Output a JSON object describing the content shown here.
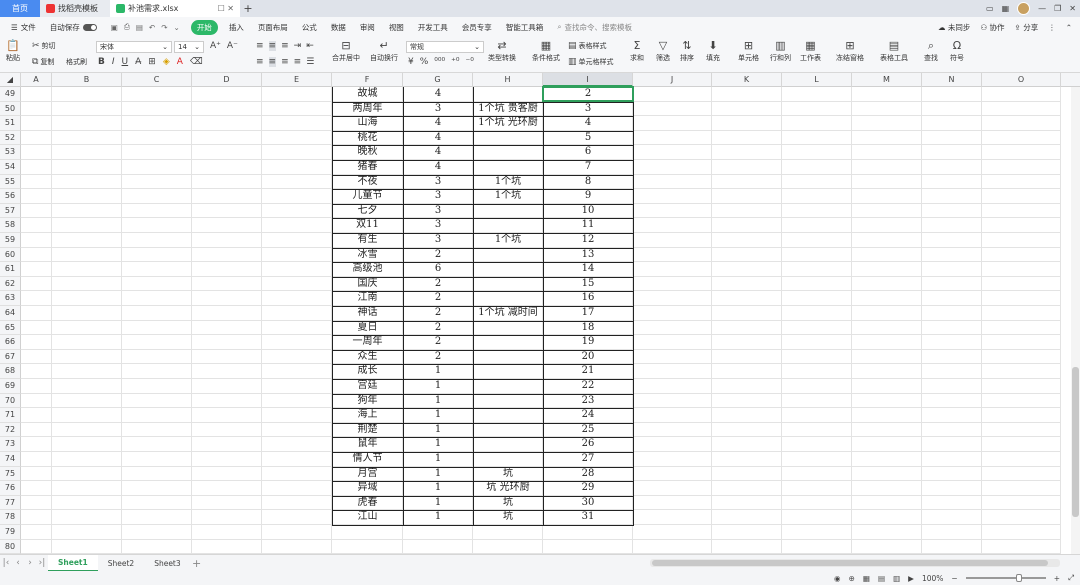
{
  "titlebar": {
    "tabs": [
      {
        "label": "首页"
      },
      {
        "label": "找稻壳模板"
      },
      {
        "label": "补池需求.xlsx"
      }
    ]
  },
  "menubar": {
    "file": "文件",
    "autosave": "自动保存",
    "items": [
      "开始",
      "插入",
      "页面布局",
      "公式",
      "数据",
      "审阅",
      "视图",
      "开发工具",
      "会员专享",
      "智能工具箱"
    ],
    "search_placeholder": "查找命令、搜索模板",
    "right": [
      "未同步",
      "协作",
      "分享"
    ]
  },
  "ribbon": {
    "paste": "粘贴",
    "cut": "剪切",
    "copy": "复制",
    "format_painter": "格式刷",
    "font_name": "宋体",
    "font_size": "14",
    "merge": "合并居中",
    "wrap": "自动换行",
    "number_format": "常规",
    "type_convert": "类型转换",
    "cond_format": "条件格式",
    "table_style": "表格样式",
    "cell_style": "单元格样式",
    "sum": "求和",
    "filter": "筛选",
    "sort": "排序",
    "fill": "填充",
    "cells": "单元格",
    "rowcol": "行和列",
    "worksheet": "工作表",
    "freeze": "冻结窗格",
    "table_tools": "表格工具",
    "find": "查找",
    "symbol": "符号"
  },
  "grid": {
    "columns": [
      "A",
      "B",
      "C",
      "D",
      "E",
      "F",
      "G",
      "H",
      "I",
      "J",
      "K",
      "L",
      "M",
      "N",
      "O"
    ],
    "rows": [
      {
        "n": "49",
        "f": "故城",
        "g": "4",
        "h": "",
        "i": "2"
      },
      {
        "n": "50",
        "f": "两周年",
        "g": "3",
        "h": "1个坑  贵客厨",
        "i": "3"
      },
      {
        "n": "51",
        "f": "山海",
        "g": "4",
        "h": "1个坑  光环厨",
        "i": "4"
      },
      {
        "n": "52",
        "f": "桃花",
        "g": "4",
        "h": "",
        "i": "5"
      },
      {
        "n": "53",
        "f": "晚秋",
        "g": "4",
        "h": "",
        "i": "6"
      },
      {
        "n": "54",
        "f": "猪春",
        "g": "4",
        "h": "",
        "i": "7"
      },
      {
        "n": "55",
        "f": "不夜",
        "g": "3",
        "h": "1个坑",
        "i": "8"
      },
      {
        "n": "56",
        "f": "儿童节",
        "g": "3",
        "h": "1个坑",
        "i": "9"
      },
      {
        "n": "57",
        "f": "七夕",
        "g": "3",
        "h": "",
        "i": "10"
      },
      {
        "n": "58",
        "f": "双11",
        "g": "3",
        "h": "",
        "i": "11"
      },
      {
        "n": "59",
        "f": "有生",
        "g": "3",
        "h": "1个坑",
        "i": "12"
      },
      {
        "n": "60",
        "f": "冰雪",
        "g": "2",
        "h": "",
        "i": "13"
      },
      {
        "n": "61",
        "f": "高级池",
        "g": "6",
        "h": "",
        "i": "14"
      },
      {
        "n": "62",
        "f": "国庆",
        "g": "2",
        "h": "",
        "i": "15"
      },
      {
        "n": "63",
        "f": "江南",
        "g": "2",
        "h": "",
        "i": "16"
      },
      {
        "n": "64",
        "f": "神话",
        "g": "2",
        "h": "1个坑  减时间",
        "i": "17"
      },
      {
        "n": "65",
        "f": "夏日",
        "g": "2",
        "h": "",
        "i": "18"
      },
      {
        "n": "66",
        "f": "一周年",
        "g": "2",
        "h": "",
        "i": "19"
      },
      {
        "n": "67",
        "f": "众生",
        "g": "2",
        "h": "",
        "i": "20"
      },
      {
        "n": "68",
        "f": "成长",
        "g": "1",
        "h": "",
        "i": "21"
      },
      {
        "n": "69",
        "f": "宫廷",
        "g": "1",
        "h": "",
        "i": "22"
      },
      {
        "n": "70",
        "f": "狗年",
        "g": "1",
        "h": "",
        "i": "23"
      },
      {
        "n": "71",
        "f": "海上",
        "g": "1",
        "h": "",
        "i": "24"
      },
      {
        "n": "72",
        "f": "荆楚",
        "g": "1",
        "h": "",
        "i": "25"
      },
      {
        "n": "73",
        "f": "鼠年",
        "g": "1",
        "h": "",
        "i": "26"
      },
      {
        "n": "74",
        "f": "情人节",
        "g": "1",
        "h": "",
        "i": "27"
      },
      {
        "n": "75",
        "f": "月宫",
        "g": "1",
        "h": "坑",
        "i": "28"
      },
      {
        "n": "76",
        "f": "异域",
        "g": "1",
        "h": "坑  光环厨",
        "i": "29"
      },
      {
        "n": "77",
        "f": "虎春",
        "g": "1",
        "h": "坑",
        "i": "30"
      },
      {
        "n": "78",
        "f": "江山",
        "g": "1",
        "h": "坑",
        "i": "31"
      },
      {
        "n": "79",
        "f": "",
        "g": "",
        "h": "",
        "i": ""
      },
      {
        "n": "80",
        "f": "",
        "g": "",
        "h": "",
        "i": ""
      }
    ]
  },
  "sheets": [
    "Sheet1",
    "Sheet2",
    "Sheet3"
  ],
  "status": {
    "zoom": "100%"
  }
}
